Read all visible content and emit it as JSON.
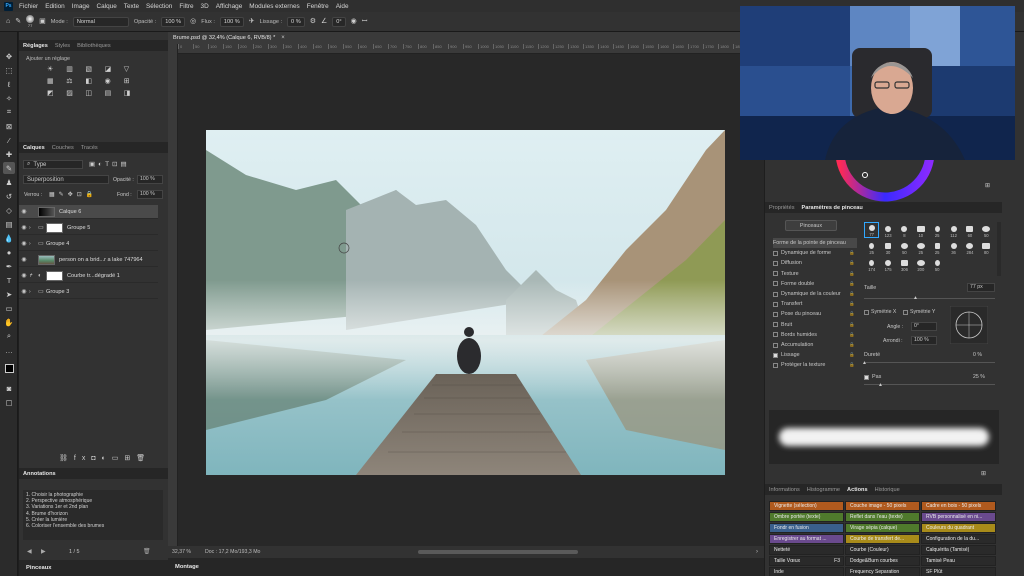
{
  "app": {
    "logo": "Ps"
  },
  "menu": [
    "Fichier",
    "Edition",
    "Image",
    "Calque",
    "Texte",
    "Sélection",
    "Filtre",
    "3D",
    "Affichage",
    "Modules externes",
    "Fenêtre",
    "Aide"
  ],
  "options": {
    "size": "77",
    "mode_label": "Mode :",
    "mode_value": "Normal",
    "opacity_label": "Opacité :",
    "opacity_value": "100 %",
    "flux_label": "Flux :",
    "flux_value": "100 %",
    "lissage_label": "Lissage :",
    "lissage_value": "0 %",
    "angle_value": "0°"
  },
  "left_panel": {
    "tabs_top": [
      "Réglages",
      "Styles",
      "Bibliothèques"
    ],
    "adjust_label": "Ajouter un réglage",
    "tabs_layers": [
      "Calques",
      "Couches",
      "Tracés"
    ],
    "filter_type": "Type",
    "blend_mode": "Superposition",
    "opacity_label": "Opacité :",
    "opacity_value": "100 %",
    "lock_label": "Verrou :",
    "fill_label": "Fond :",
    "fill_value": "100 %",
    "layers": [
      {
        "name": "Calque 6"
      },
      {
        "name": "Groupe 5"
      },
      {
        "name": "Groupe 4"
      },
      {
        "name": "person on a brid...r a lake 747964"
      },
      {
        "name": "Courbe tr...dégradé 1"
      },
      {
        "name": "Groupe 3"
      }
    ],
    "annotations_title": "Annotations",
    "annotations": [
      "1. Choisir la photographie",
      "2. Perspective atmosphérique",
      "3. Variations 1er et 2nd plan",
      "4. Brume d'horizon",
      "5. Créer la lumière",
      "6. Coloriser l'ensemble des brumes"
    ],
    "page_indicator": "1 / 5",
    "bottom_tab": "Pinceaux"
  },
  "document": {
    "tab_title": "Brume.psd @ 32,4% (Calque 6, RVB/8) *",
    "ruler_marks": [
      "0",
      "50",
      "100",
      "150",
      "200",
      "250",
      "300",
      "350",
      "400",
      "450",
      "500",
      "550",
      "600",
      "650",
      "700",
      "750",
      "800",
      "850",
      "900",
      "950",
      "1000",
      "1050",
      "1100",
      "1150",
      "1200",
      "1250",
      "1300",
      "1350",
      "1400",
      "1450",
      "1500",
      "1550",
      "1600",
      "1650",
      "1700",
      "1750",
      "1800",
      "1850",
      "1900"
    ],
    "zoom": "32,37 %",
    "doc_info": "Doc : 17,2 Mo/193,3 Mo",
    "bottom_tab": "Montage"
  },
  "right_panel": {
    "tabs": [
      "Propriétés",
      "Paramètres de pinceau"
    ],
    "pinceaux_button": "Pinceaux",
    "brush_options": [
      {
        "label": "Forme de la pointe de pinceau",
        "checked": false,
        "active": true
      },
      {
        "label": "Dynamique de forme",
        "checked": false
      },
      {
        "label": "Diffusion",
        "checked": false
      },
      {
        "label": "Texture",
        "checked": false
      },
      {
        "label": "Forme double",
        "checked": false
      },
      {
        "label": "Dynamique de la couleur",
        "checked": false
      },
      {
        "label": "Transfert",
        "checked": false
      },
      {
        "label": "Pose du pinceau",
        "checked": false
      },
      {
        "label": "Bruit",
        "checked": false
      },
      {
        "label": "Bords humides",
        "checked": false
      },
      {
        "label": "Accumulation",
        "checked": false
      },
      {
        "label": "Lissage",
        "checked": true
      },
      {
        "label": "Protéger la texture",
        "checked": false
      }
    ],
    "brush_sizes": [
      "77",
      "123",
      "8",
      "10",
      "25",
      "112",
      "60",
      "50",
      "25",
      "30",
      "50",
      "25",
      "25",
      "36",
      "284",
      "80",
      "174",
      "175",
      "306",
      "200",
      "50"
    ],
    "taille_label": "Taille",
    "taille_value": "77 px",
    "symx": "Symétrie X",
    "symy": "Symétrie Y",
    "angle_label": "Angle :",
    "angle_value": "0°",
    "arrondi_label": "Arrondi :",
    "arrondi_value": "100 %",
    "durete_label": "Dureté",
    "durete_value": "0 %",
    "pas_label": "Pas",
    "pas_value": "25 %",
    "tabs_bottom": [
      "Informations",
      "Histogramme",
      "Actions",
      "Historique"
    ],
    "actions": [
      {
        "label": "Vignette (sélection)",
        "color": "#b05a1e"
      },
      {
        "label": "Couche image - 50 pixels",
        "color": "#b05a1e"
      },
      {
        "label": "Cadre en bois - 50 pixels",
        "color": "#b05a1e"
      },
      {
        "label": "Ombre portée (texte)",
        "color": "#4f7a2c"
      },
      {
        "label": "Reflet dans l'eau (texte)",
        "color": "#4f7a2c"
      },
      {
        "label": "RVB personnalisé en ni...",
        "color": "#6a4a8e"
      },
      {
        "label": "Fondr en fusion",
        "color": "#3a5f8c"
      },
      {
        "label": "Virage sépia (calque)",
        "color": "#4f7a2c"
      },
      {
        "label": "Couleurs du quadrant",
        "color": "#a88b1a"
      },
      {
        "label": "Enregistrer au format ...",
        "color": "#6a4a8e"
      },
      {
        "label": "Courbe de transfert de...",
        "color": "#a88b1a"
      },
      {
        "label": "Configuration de la du...",
        "color": "#2a2a2a"
      },
      {
        "label": "Netteté",
        "color": "#2a2a2a"
      },
      {
        "label": "Courbe (Couleur)",
        "color": "#2a2a2a"
      },
      {
        "label": "Calquérita (Tamisé)",
        "color": "#2a2a2a"
      },
      {
        "label": "Taille Vœux",
        "color": "#2a2a2a"
      },
      {
        "label": "Dodge&Burn courbes",
        "color": "#2a2a2a"
      },
      {
        "label": "Tamisé Peau",
        "color": "#2a2a2a"
      },
      {
        "label": "Inde",
        "color": "#2a2a2a"
      },
      {
        "label": "Frequency Separation",
        "color": "#2a2a2a"
      },
      {
        "label": "SF Plût",
        "color": "#2a2a2a"
      }
    ],
    "shortcut": "F3"
  },
  "colors": {
    "accent": "#31a8ff",
    "panel": "#323232",
    "menubar": "#2f2f2f"
  }
}
